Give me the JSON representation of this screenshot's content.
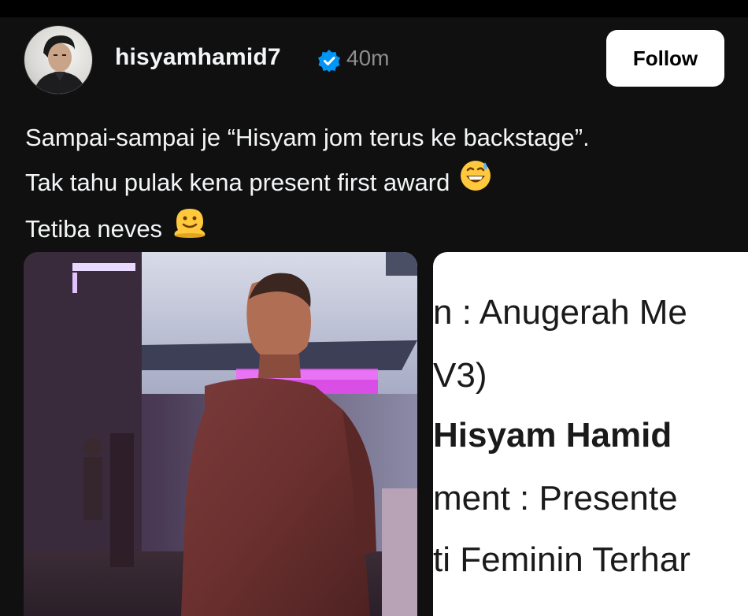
{
  "post": {
    "username": "hisyamhamid7",
    "verified_icon": "verified-badge-icon",
    "time": "40m",
    "follow_label": "Follow",
    "caption": {
      "line1": "Sampai-sampai je “Hisyam jom terus ke backstage”.",
      "line2": "Tak tahu pulak kena present first award",
      "line2_emoji": "grinning-sweat-emoji",
      "line3": "Tetiba neves",
      "line3_emoji": "melting-face-emoji"
    }
  },
  "media": {
    "photo_icon": "backstage-photo",
    "document": {
      "line1": "n : Anugerah Me",
      "line2": "V3)",
      "line3": "Hisyam Hamid",
      "line4": "ment : Presente",
      "line5": "ti Feminin Terhar"
    }
  },
  "colors": {
    "background": "#101010",
    "text": "#f3f5f7",
    "muted": "#8e8e8e",
    "verified": "#0095f6",
    "button_bg": "#ffffff"
  }
}
